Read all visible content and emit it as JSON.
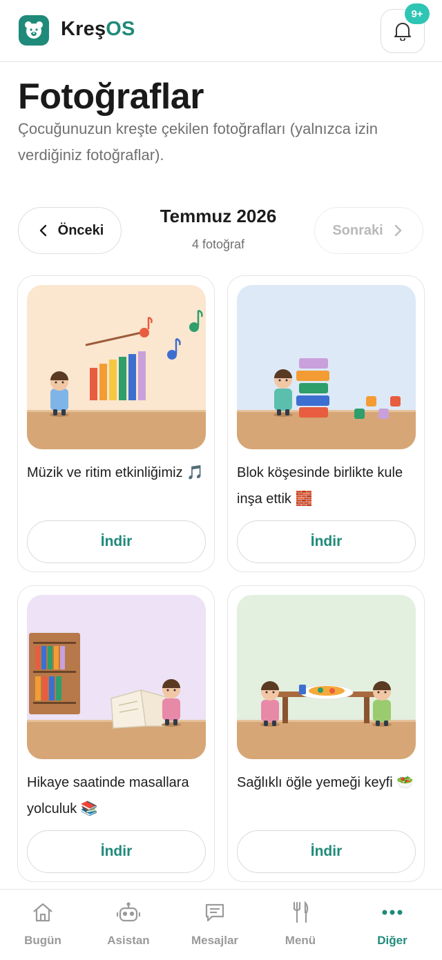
{
  "header": {
    "brand_prefix": "Kreş",
    "brand_suffix": "OS",
    "notification_badge": "9+",
    "accent_color": "#1f8a7a"
  },
  "page": {
    "title": "Fotoğraflar",
    "description": "Çocuğunuzun kreşte çekilen fotoğrafları (yalnızca izin verdiğiniz fotoğraflar)."
  },
  "month_nav": {
    "prev_label": "Önceki",
    "next_label": "Sonraki",
    "month": "Temmuz 2026",
    "count": "4 fotoğraf"
  },
  "photos": [
    {
      "caption": "Müzik ve ritim etkinliğimiz 🎵",
      "download_label": "İndir"
    },
    {
      "caption": "Blok köşesinde birlikte kule inşa ettik 🧱",
      "download_label": "İndir"
    },
    {
      "caption": "Hikaye saatinde masallara yolculuk 📚",
      "download_label": "İndir"
    },
    {
      "caption": "Sağlıklı öğle yemeği keyfi 🥗",
      "download_label": "İndir"
    }
  ],
  "bottom_nav": {
    "items": [
      {
        "label": "Bugün",
        "icon": "home-icon"
      },
      {
        "label": "Asistan",
        "icon": "robot-icon"
      },
      {
        "label": "Mesajlar",
        "icon": "message-icon"
      },
      {
        "label": "Menü",
        "icon": "utensils-icon"
      },
      {
        "label": "Diğer",
        "icon": "more-dots-icon",
        "active": true
      }
    ]
  }
}
